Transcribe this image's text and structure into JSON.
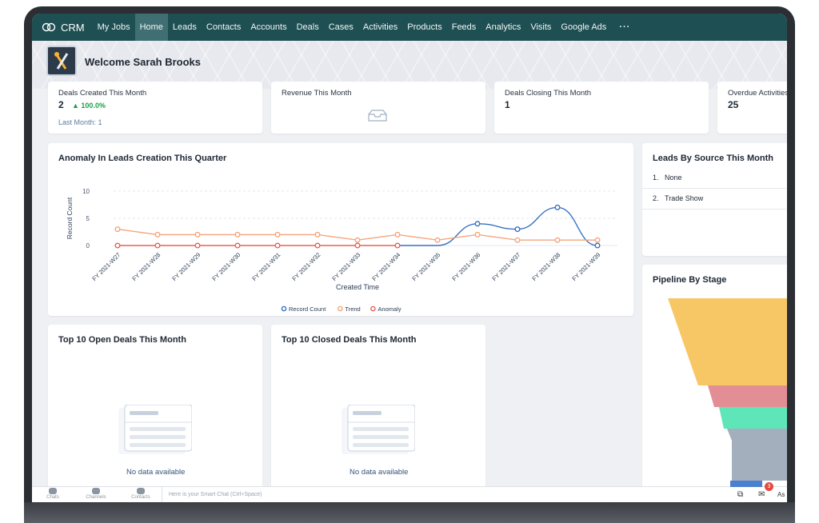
{
  "nav": {
    "brand": "CRM",
    "items": [
      "My Jobs",
      "Home",
      "Leads",
      "Contacts",
      "Accounts",
      "Deals",
      "Cases",
      "Activities",
      "Products",
      "Feeds",
      "Analytics",
      "Visits",
      "Google Ads"
    ],
    "active": "Home",
    "more": "···"
  },
  "welcome": "Welcome Sarah Brooks",
  "kpis": [
    {
      "title": "Deals Created This Month",
      "value": "2",
      "delta": "100.0%",
      "sub": "Last Month: 1"
    },
    {
      "title": "Revenue This Month",
      "value": "",
      "delta": "",
      "sub": ""
    },
    {
      "title": "Deals Closing This Month",
      "value": "1",
      "delta": "",
      "sub": ""
    },
    {
      "title": "Overdue Activities",
      "value": "25",
      "delta": "",
      "sub": ""
    }
  ],
  "anomaly_card": {
    "title": "Anomaly In Leads Creation This Quarter"
  },
  "chart_data": {
    "type": "line",
    "title": "Anomaly In Leads Creation This Quarter",
    "xlabel": "Created Time",
    "ylabel": "Record Count",
    "ylim": [
      0,
      10
    ],
    "yticks": [
      0,
      5,
      10
    ],
    "categories": [
      "FY 2021-W27",
      "FY 2021-W28",
      "FY 2021-W29",
      "FY 2021-W30",
      "FY 2021-W31",
      "FY 2021-W32",
      "FY 2021-W33",
      "FY 2021-W34",
      "FY 2021-W35",
      "FY 2021-W36",
      "FY 2021-W37",
      "FY 2021-W38",
      "FY 2021-W39"
    ],
    "series": [
      {
        "name": "Record Count",
        "color": "#3a72c4",
        "values": [
          null,
          null,
          null,
          null,
          null,
          null,
          null,
          0,
          0,
          4,
          3,
          7,
          0
        ],
        "markers": [
          false,
          false,
          false,
          false,
          false,
          false,
          false,
          false,
          false,
          true,
          true,
          true,
          true
        ]
      },
      {
        "name": "Trend",
        "color": "#f4a57c",
        "values": [
          3,
          2,
          2,
          2,
          2,
          2,
          1,
          2,
          1,
          2,
          1,
          1,
          1
        ],
        "markers": [
          true,
          true,
          true,
          true,
          true,
          true,
          true,
          true,
          true,
          true,
          true,
          true,
          true
        ]
      },
      {
        "name": "Anomaly",
        "color": "#e5625a",
        "values": [
          0,
          0,
          0,
          0,
          0,
          0,
          0,
          0,
          null,
          null,
          null,
          null,
          null
        ],
        "markers": [
          true,
          true,
          true,
          true,
          true,
          true,
          true,
          true,
          false,
          false,
          false,
          false,
          false
        ]
      }
    ],
    "legend_position": "bottom",
    "grid": true
  },
  "leads_by_source": {
    "title": "Leads By Source This Month",
    "rows": [
      {
        "num": "1.",
        "label": "None"
      },
      {
        "num": "2.",
        "label": "Trade Show"
      }
    ]
  },
  "pipeline": {
    "title": "Pipeline By Stage"
  },
  "open_deals": {
    "title": "Top 10 Open Deals This Month",
    "empty": "No data available"
  },
  "closed_deals": {
    "title": "Top 10 Closed Deals This Month",
    "empty": "No data available"
  },
  "bottombar": {
    "items": [
      "Chats",
      "Channels",
      "Contacts"
    ],
    "smart_chat_placeholder": "Here is your Smart Chat (Ctrl+Space)",
    "badge": "3",
    "right_text": "As"
  }
}
